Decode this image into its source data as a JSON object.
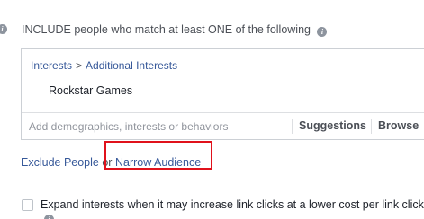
{
  "section": {
    "heading": "INCLUDE people who match at least ONE of the following",
    "info_icon": "info-icon"
  },
  "targeting_box": {
    "breadcrumb": {
      "parent": "Interests",
      "separator": ">",
      "child": "Additional Interests"
    },
    "items": [
      "Rockstar Games"
    ],
    "search": {
      "placeholder": "Add demographics, interests or behaviors",
      "suggestions_label": "Suggestions",
      "browse_label": "Browse"
    }
  },
  "links": {
    "exclude_label": "Exclude People",
    "or_label": "or",
    "narrow_label": "Narrow Audience"
  },
  "expand_option": {
    "label": "Expand interests when it may increase link clicks at a lower cost per link click.",
    "checked": false
  },
  "colors": {
    "link": "#365899",
    "highlight": "#e0111b",
    "muted": "#90949c"
  }
}
